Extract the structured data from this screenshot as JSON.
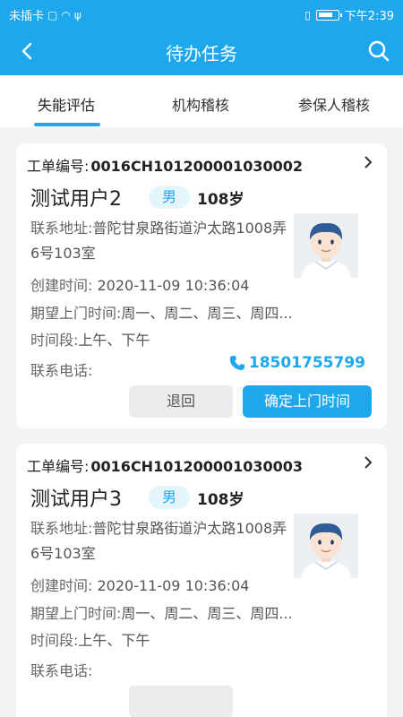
{
  "status_bar": {
    "carrier": "未插卡",
    "time": "下午2:39"
  },
  "nav": {
    "title": "待办任务",
    "back_icon": "back-arrow-icon",
    "search_icon": "search-icon"
  },
  "tabs": [
    {
      "label": "失能评估",
      "active": true
    },
    {
      "label": "机构稽核",
      "active": false
    },
    {
      "label": "参保人稽核",
      "active": false
    }
  ],
  "cards": [
    {
      "order_label": "工单编号:",
      "order_no": "0016CH101200001030002",
      "name": "测试用户2",
      "gender": "男",
      "age": "108岁",
      "address_label": "联系地址:",
      "address": "普陀甘泉路街道沪太路1008弄6号103室",
      "created_label": "创建时间:",
      "created": "2020-11-09 10:36:04",
      "expect_label": "期望上门时间:",
      "expect": "周一、周二、周三、周四...",
      "period_label": "时间段:",
      "period": "上午、下午",
      "phone_label": "联系电话:",
      "phone": "18501755799",
      "btn_return": "退回",
      "btn_confirm": "确定上门时间"
    },
    {
      "order_label": "工单编号:",
      "order_no": "0016CH101200001030003",
      "name": "测试用户3",
      "gender": "男",
      "age": "108岁",
      "address_label": "联系地址:",
      "address": "普陀甘泉路街道沪太路1008弄6号103室",
      "created_label": "创建时间:",
      "created": "2020-11-09 10:36:04",
      "expect_label": "期望上门时间:",
      "expect": "周一、周二、周三、周四...",
      "period_label": "时间段:",
      "period": "上午、下午",
      "phone_label": "联系电话:"
    }
  ],
  "colors": {
    "primary": "#1ea7ec",
    "background": "#f2f3f5"
  }
}
